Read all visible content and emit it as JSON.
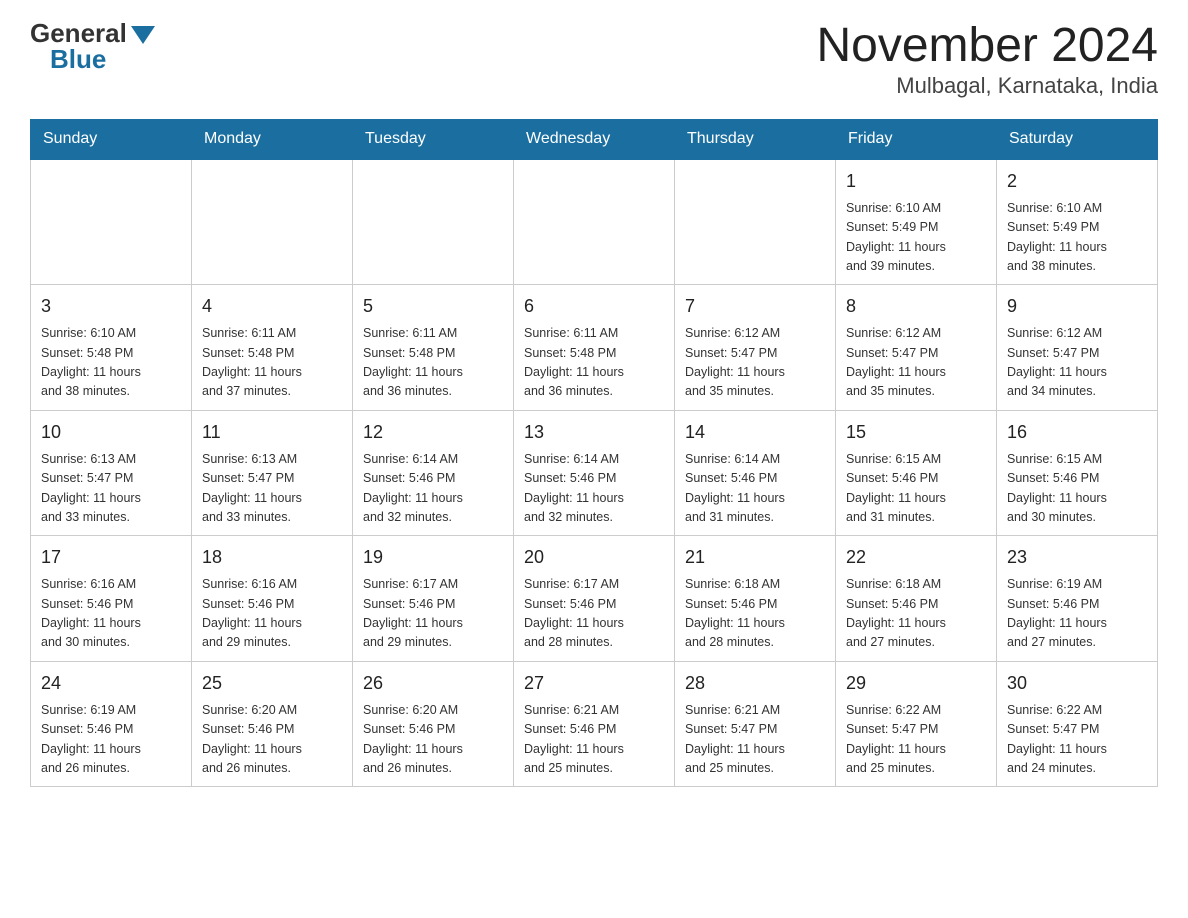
{
  "header": {
    "logo_general": "General",
    "logo_blue": "Blue",
    "month_title": "November 2024",
    "location": "Mulbagal, Karnataka, India"
  },
  "weekdays": [
    "Sunday",
    "Monday",
    "Tuesday",
    "Wednesday",
    "Thursday",
    "Friday",
    "Saturday"
  ],
  "weeks": [
    [
      {
        "day": "",
        "info": ""
      },
      {
        "day": "",
        "info": ""
      },
      {
        "day": "",
        "info": ""
      },
      {
        "day": "",
        "info": ""
      },
      {
        "day": "",
        "info": ""
      },
      {
        "day": "1",
        "info": "Sunrise: 6:10 AM\nSunset: 5:49 PM\nDaylight: 11 hours\nand 39 minutes."
      },
      {
        "day": "2",
        "info": "Sunrise: 6:10 AM\nSunset: 5:49 PM\nDaylight: 11 hours\nand 38 minutes."
      }
    ],
    [
      {
        "day": "3",
        "info": "Sunrise: 6:10 AM\nSunset: 5:48 PM\nDaylight: 11 hours\nand 38 minutes."
      },
      {
        "day": "4",
        "info": "Sunrise: 6:11 AM\nSunset: 5:48 PM\nDaylight: 11 hours\nand 37 minutes."
      },
      {
        "day": "5",
        "info": "Sunrise: 6:11 AM\nSunset: 5:48 PM\nDaylight: 11 hours\nand 36 minutes."
      },
      {
        "day": "6",
        "info": "Sunrise: 6:11 AM\nSunset: 5:48 PM\nDaylight: 11 hours\nand 36 minutes."
      },
      {
        "day": "7",
        "info": "Sunrise: 6:12 AM\nSunset: 5:47 PM\nDaylight: 11 hours\nand 35 minutes."
      },
      {
        "day": "8",
        "info": "Sunrise: 6:12 AM\nSunset: 5:47 PM\nDaylight: 11 hours\nand 35 minutes."
      },
      {
        "day": "9",
        "info": "Sunrise: 6:12 AM\nSunset: 5:47 PM\nDaylight: 11 hours\nand 34 minutes."
      }
    ],
    [
      {
        "day": "10",
        "info": "Sunrise: 6:13 AM\nSunset: 5:47 PM\nDaylight: 11 hours\nand 33 minutes."
      },
      {
        "day": "11",
        "info": "Sunrise: 6:13 AM\nSunset: 5:47 PM\nDaylight: 11 hours\nand 33 minutes."
      },
      {
        "day": "12",
        "info": "Sunrise: 6:14 AM\nSunset: 5:46 PM\nDaylight: 11 hours\nand 32 minutes."
      },
      {
        "day": "13",
        "info": "Sunrise: 6:14 AM\nSunset: 5:46 PM\nDaylight: 11 hours\nand 32 minutes."
      },
      {
        "day": "14",
        "info": "Sunrise: 6:14 AM\nSunset: 5:46 PM\nDaylight: 11 hours\nand 31 minutes."
      },
      {
        "day": "15",
        "info": "Sunrise: 6:15 AM\nSunset: 5:46 PM\nDaylight: 11 hours\nand 31 minutes."
      },
      {
        "day": "16",
        "info": "Sunrise: 6:15 AM\nSunset: 5:46 PM\nDaylight: 11 hours\nand 30 minutes."
      }
    ],
    [
      {
        "day": "17",
        "info": "Sunrise: 6:16 AM\nSunset: 5:46 PM\nDaylight: 11 hours\nand 30 minutes."
      },
      {
        "day": "18",
        "info": "Sunrise: 6:16 AM\nSunset: 5:46 PM\nDaylight: 11 hours\nand 29 minutes."
      },
      {
        "day": "19",
        "info": "Sunrise: 6:17 AM\nSunset: 5:46 PM\nDaylight: 11 hours\nand 29 minutes."
      },
      {
        "day": "20",
        "info": "Sunrise: 6:17 AM\nSunset: 5:46 PM\nDaylight: 11 hours\nand 28 minutes."
      },
      {
        "day": "21",
        "info": "Sunrise: 6:18 AM\nSunset: 5:46 PM\nDaylight: 11 hours\nand 28 minutes."
      },
      {
        "day": "22",
        "info": "Sunrise: 6:18 AM\nSunset: 5:46 PM\nDaylight: 11 hours\nand 27 minutes."
      },
      {
        "day": "23",
        "info": "Sunrise: 6:19 AM\nSunset: 5:46 PM\nDaylight: 11 hours\nand 27 minutes."
      }
    ],
    [
      {
        "day": "24",
        "info": "Sunrise: 6:19 AM\nSunset: 5:46 PM\nDaylight: 11 hours\nand 26 minutes."
      },
      {
        "day": "25",
        "info": "Sunrise: 6:20 AM\nSunset: 5:46 PM\nDaylight: 11 hours\nand 26 minutes."
      },
      {
        "day": "26",
        "info": "Sunrise: 6:20 AM\nSunset: 5:46 PM\nDaylight: 11 hours\nand 26 minutes."
      },
      {
        "day": "27",
        "info": "Sunrise: 6:21 AM\nSunset: 5:46 PM\nDaylight: 11 hours\nand 25 minutes."
      },
      {
        "day": "28",
        "info": "Sunrise: 6:21 AM\nSunset: 5:47 PM\nDaylight: 11 hours\nand 25 minutes."
      },
      {
        "day": "29",
        "info": "Sunrise: 6:22 AM\nSunset: 5:47 PM\nDaylight: 11 hours\nand 25 minutes."
      },
      {
        "day": "30",
        "info": "Sunrise: 6:22 AM\nSunset: 5:47 PM\nDaylight: 11 hours\nand 24 minutes."
      }
    ]
  ]
}
